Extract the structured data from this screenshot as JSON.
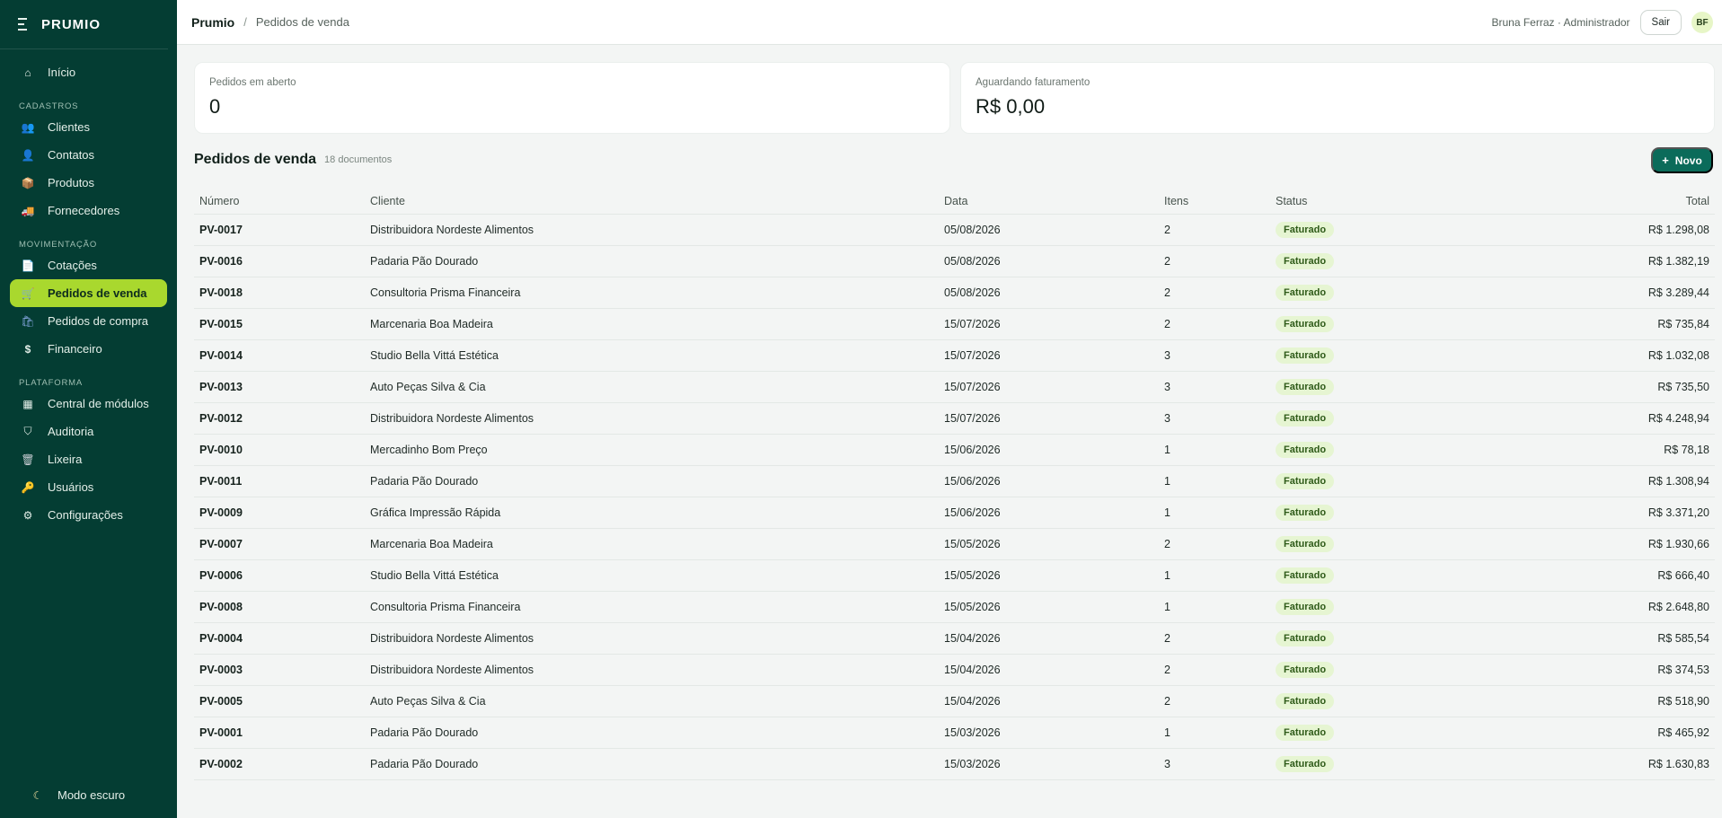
{
  "brand": {
    "name": "PRUMIO"
  },
  "sidebar": {
    "home": {
      "label": "Início"
    },
    "sections": [
      {
        "title": "CADASTROS",
        "items": [
          {
            "label": "Clientes",
            "icon": "users-icon"
          },
          {
            "label": "Contatos",
            "icon": "person-icon"
          },
          {
            "label": "Produtos",
            "icon": "box-icon"
          },
          {
            "label": "Fornecedores",
            "icon": "truck-icon"
          }
        ]
      },
      {
        "title": "MOVIMENTAÇÃO",
        "items": [
          {
            "label": "Cotações",
            "icon": "document-icon"
          },
          {
            "label": "Pedidos de venda",
            "icon": "cart-icon",
            "active": true
          },
          {
            "label": "Pedidos de compra",
            "icon": "shopping-bag-icon"
          },
          {
            "label": "Financeiro",
            "icon": "dollar-icon"
          }
        ]
      },
      {
        "title": "PLATAFORMA",
        "items": [
          {
            "label": "Central de módulos",
            "icon": "grid-icon"
          },
          {
            "label": "Auditoria",
            "icon": "shield-icon"
          },
          {
            "label": "Lixeira",
            "icon": "trash-icon"
          },
          {
            "label": "Usuários",
            "icon": "key-icon"
          },
          {
            "label": "Configurações",
            "icon": "gear-icon"
          }
        ]
      }
    ],
    "dark_mode": {
      "label": "Modo escuro",
      "icon": "moon-icon"
    }
  },
  "header": {
    "breadcrumb_root": "Prumio",
    "breadcrumb_sep": "/",
    "breadcrumb_current": "Pedidos de venda",
    "user": "Bruna Ferraz · Administrador",
    "logout_label": "Sair",
    "avatar_initials": "BF"
  },
  "cards": [
    {
      "label": "Pedidos em aberto",
      "value": "0"
    },
    {
      "label": "Aguardando faturamento",
      "value": "R$ 0,00"
    }
  ],
  "list": {
    "title": "Pedidos de venda",
    "count": "18 documentos",
    "new_label": "Novo",
    "new_icon": "+"
  },
  "table": {
    "columns": [
      "Número",
      "Cliente",
      "Data",
      "Itens",
      "Status",
      "Total"
    ],
    "rows": [
      [
        "PV-0017",
        "Distribuidora Nordeste Alimentos",
        "05/08/2026",
        "2",
        "Faturado",
        "R$ 1.298,08"
      ],
      [
        "PV-0016",
        "Padaria Pão Dourado",
        "05/08/2026",
        "2",
        "Faturado",
        "R$ 1.382,19"
      ],
      [
        "PV-0018",
        "Consultoria Prisma Financeira",
        "05/08/2026",
        "2",
        "Faturado",
        "R$ 3.289,44"
      ],
      [
        "PV-0015",
        "Marcenaria Boa Madeira",
        "15/07/2026",
        "2",
        "Faturado",
        "R$ 735,84"
      ],
      [
        "PV-0014",
        "Studio Bella Vittá Estética",
        "15/07/2026",
        "3",
        "Faturado",
        "R$ 1.032,08"
      ],
      [
        "PV-0013",
        "Auto Peças Silva & Cia",
        "15/07/2026",
        "3",
        "Faturado",
        "R$ 735,50"
      ],
      [
        "PV-0012",
        "Distribuidora Nordeste Alimentos",
        "15/07/2026",
        "3",
        "Faturado",
        "R$ 4.248,94"
      ],
      [
        "PV-0010",
        "Mercadinho Bom Preço",
        "15/06/2026",
        "1",
        "Faturado",
        "R$ 78,18"
      ],
      [
        "PV-0011",
        "Padaria Pão Dourado",
        "15/06/2026",
        "1",
        "Faturado",
        "R$ 1.308,94"
      ],
      [
        "PV-0009",
        "Gráfica Impressão Rápida",
        "15/06/2026",
        "1",
        "Faturado",
        "R$ 3.371,20"
      ],
      [
        "PV-0007",
        "Marcenaria Boa Madeira",
        "15/05/2026",
        "2",
        "Faturado",
        "R$ 1.930,66"
      ],
      [
        "PV-0006",
        "Studio Bella Vittá Estética",
        "15/05/2026",
        "1",
        "Faturado",
        "R$ 666,40"
      ],
      [
        "PV-0008",
        "Consultoria Prisma Financeira",
        "15/05/2026",
        "1",
        "Faturado",
        "R$ 2.648,80"
      ],
      [
        "PV-0004",
        "Distribuidora Nordeste Alimentos",
        "15/04/2026",
        "2",
        "Faturado",
        "R$ 585,54"
      ],
      [
        "PV-0003",
        "Distribuidora Nordeste Alimentos",
        "15/04/2026",
        "2",
        "Faturado",
        "R$ 374,53"
      ],
      [
        "PV-0005",
        "Auto Peças Silva & Cia",
        "15/04/2026",
        "2",
        "Faturado",
        "R$ 518,90"
      ],
      [
        "PV-0001",
        "Padaria Pão Dourado",
        "15/03/2026",
        "1",
        "Faturado",
        "R$ 465,92"
      ],
      [
        "PV-0002",
        "Padaria Pão Dourado",
        "15/03/2026",
        "3",
        "Faturado",
        "R$ 1.630,83"
      ]
    ]
  },
  "colors": {
    "sidebar_bg": "#043d33",
    "active_item": "#a9d82e",
    "primary_button": "#0b6b5a",
    "badge_bg": "#e6f5d2"
  }
}
